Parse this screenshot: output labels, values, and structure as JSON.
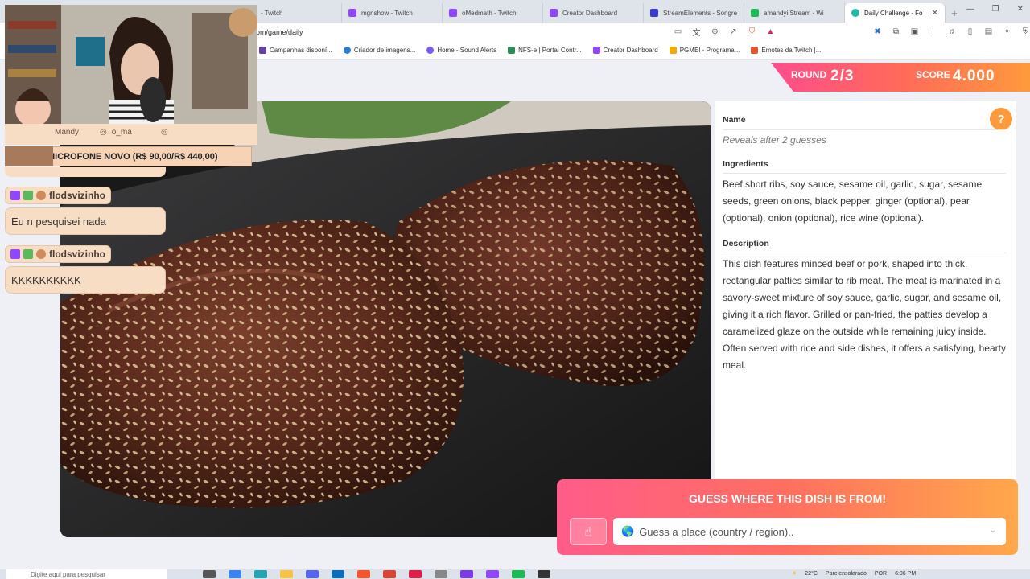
{
  "browser": {
    "tabs": [
      {
        "title": "- Twitch",
        "color": "#9146ff"
      },
      {
        "title": "mgnshow - Twitch",
        "color": "#9146ff"
      },
      {
        "title": "oMedmath - Twitch",
        "color": "#9146ff"
      },
      {
        "title": "Creator Dashboard",
        "color": "#9146ff"
      },
      {
        "title": "StreamElements - Songre",
        "color": "#3a3ad6"
      },
      {
        "title": "amandyi Stream - Wi",
        "color": "#1db954"
      },
      {
        "title": "Daily Challenge - Fo",
        "color": "#1fb8a6",
        "active": true
      }
    ],
    "new_tab": "+",
    "url": "om/game/daily",
    "bookmarks": [
      {
        "label": "Campanhas disponí...",
        "color": "#6441a5"
      },
      {
        "label": "Criador de imagens...",
        "color": "#2b7cd3"
      },
      {
        "label": "Home - Sound Alerts",
        "color": "#7a5af8"
      },
      {
        "label": "NFS-e | Portal Contr...",
        "color": "#2e8b57"
      },
      {
        "label": "Creator Dashboard",
        "color": "#9146ff"
      },
      {
        "label": "PGMEI - Programa...",
        "color": "#f2a900"
      },
      {
        "label": "Emotes da Twitch |...",
        "color": "#e4572e"
      }
    ]
  },
  "header": {
    "round_label": "ROUND",
    "round_value": "2/3",
    "score_label": "SCORE",
    "score_value": "4.000"
  },
  "info": {
    "help_icon": "?",
    "name_title": "Name",
    "name_value": "Reveals after 2 guesses",
    "ingredients_title": "Ingredients",
    "ingredients_text": "Beef short ribs, soy sauce, sesame oil, garlic, sugar, sesame seeds, green onions, black pepper, ginger (optional), pear (optional), onion (optional), rice wine (optional).",
    "description_title": "Description",
    "description_text": "This dish features minced beef or pork, shaped into thick, rectangular patties similar to rib meat. The meat is marinated in a savory-sweet mixture of soy sauce, garlic, sugar, and sesame oil, giving it a rich flavor. Grilled or pan-fried, the patties develop a caramelized glaze on the outside while remaining juicy inside. Often served with rice and side dishes, it offers a satisfying, hearty meal."
  },
  "guess": {
    "title": "GUESS WHERE THIS DISH IS FROM!",
    "placeholder": "Guess a place (country / region)..",
    "hand_icon": "hand-icon",
    "globe_icon": "globe-icon"
  },
  "overlay": {
    "social_handle": "Mandy",
    "social_handle2": "o_ma",
    "mic_banner": "MICROFONE NOVO (R$ 90,00/R$ 440,00)",
    "chat": [
      {
        "user": "flodsvizinho",
        "message": "Eu n pesquisei nada"
      },
      {
        "user": "flodsvizinho",
        "message": "KKKKKKKKKK"
      }
    ]
  },
  "taskbar": {
    "search_placeholder": "Digite aqui para pesquisar",
    "weather": "22°C",
    "weather_text": "Parc ensolarado",
    "lang": "POR",
    "time": "6:06 PM"
  }
}
